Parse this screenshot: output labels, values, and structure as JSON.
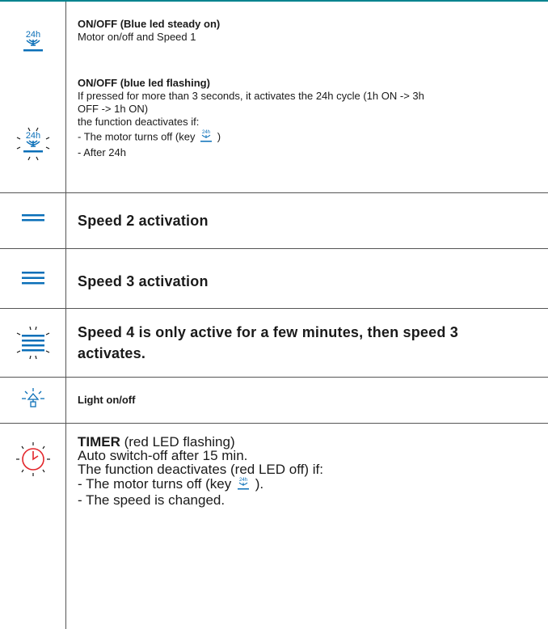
{
  "rows": {
    "onoff_steady": {
      "icon": "fan-24h-icon",
      "title": "ON/OFF (Blue led steady on)",
      "text": "Motor on/off and Speed 1"
    },
    "onoff_flashing": {
      "icon": "fan-24h-flashing-icon",
      "title": "ON/OFF (blue led flashing)",
      "line1": "If pressed for more than 3 seconds, it activates the 24h cycle (1h ON -> 3h",
      "line2": "OFF -> 1h ON)",
      "line3": "the function deactivates if:",
      "line4_pre": "- The motor turns off (key",
      "line4_post": ")",
      "line5": "- After 24h"
    },
    "speed2": {
      "icon": "speed-2-bars-icon",
      "text": "Speed 2 activation"
    },
    "speed3": {
      "icon": "speed-3-bars-icon",
      "text": "Speed 3 activation"
    },
    "speed4": {
      "icon": "speed-4-flashing-icon",
      "line1": "Speed 4 is only active for a few minutes, then speed 3",
      "line2": "activates."
    },
    "light": {
      "icon": "light-bulb-icon",
      "text": "Light on/off"
    },
    "timer": {
      "icon": "timer-clock-icon",
      "title_bold": "TIMER",
      "title_rest": " (red LED flashing)",
      "line1": "Auto switch-off after 15 min.",
      "line2": "The function deactivates (red LED off) if:",
      "line3_pre": "- The motor turns off (key",
      "line3_post": ").",
      "line4": "- The speed is changed."
    }
  },
  "icon_label_24h": "24h",
  "colors": {
    "accent": "#00838f",
    "blue": "#0a6fb8",
    "red": "#e3262b",
    "border": "#555555"
  }
}
